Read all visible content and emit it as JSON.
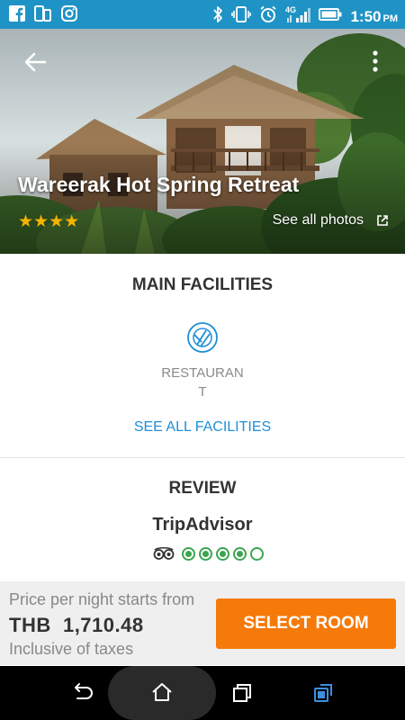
{
  "status_bar": {
    "left_icons": [
      "facebook-icon",
      "phone-icon",
      "instagram-icon"
    ],
    "right_icons": [
      "bluetooth-icon",
      "vibrate-icon",
      "alarm-icon",
      "signal-4g-icon",
      "battery-icon"
    ],
    "network_label": "4G",
    "time": "1:50",
    "ampm": "PM",
    "color": "#1f93c5"
  },
  "hero": {
    "hotel_name": "Wareerak Hot Spring Retreat",
    "stars": "★★★★",
    "star_count": 4,
    "see_photos": "See all photos"
  },
  "facilities": {
    "title": "MAIN FACILITIES",
    "items": [
      {
        "icon": "restaurant-icon",
        "label": "RESTAURANT"
      }
    ],
    "see_all": "SEE ALL FACILITIES"
  },
  "review": {
    "title": "REVIEW",
    "provider": "TripAdvisor",
    "rating_bubbles": 4,
    "max_bubbles": 5
  },
  "footer": {
    "price_caption": "Price per night starts from",
    "currency": "THB",
    "price": "1,710.48",
    "tax_caption": "Inclusive of taxes",
    "select_label": "SELECT ROOM",
    "accent": "#f57a0a"
  },
  "nav": {
    "icons": [
      "back-nav-icon",
      "home-nav-icon",
      "recents-nav-icon",
      "screenshot-icon"
    ]
  }
}
